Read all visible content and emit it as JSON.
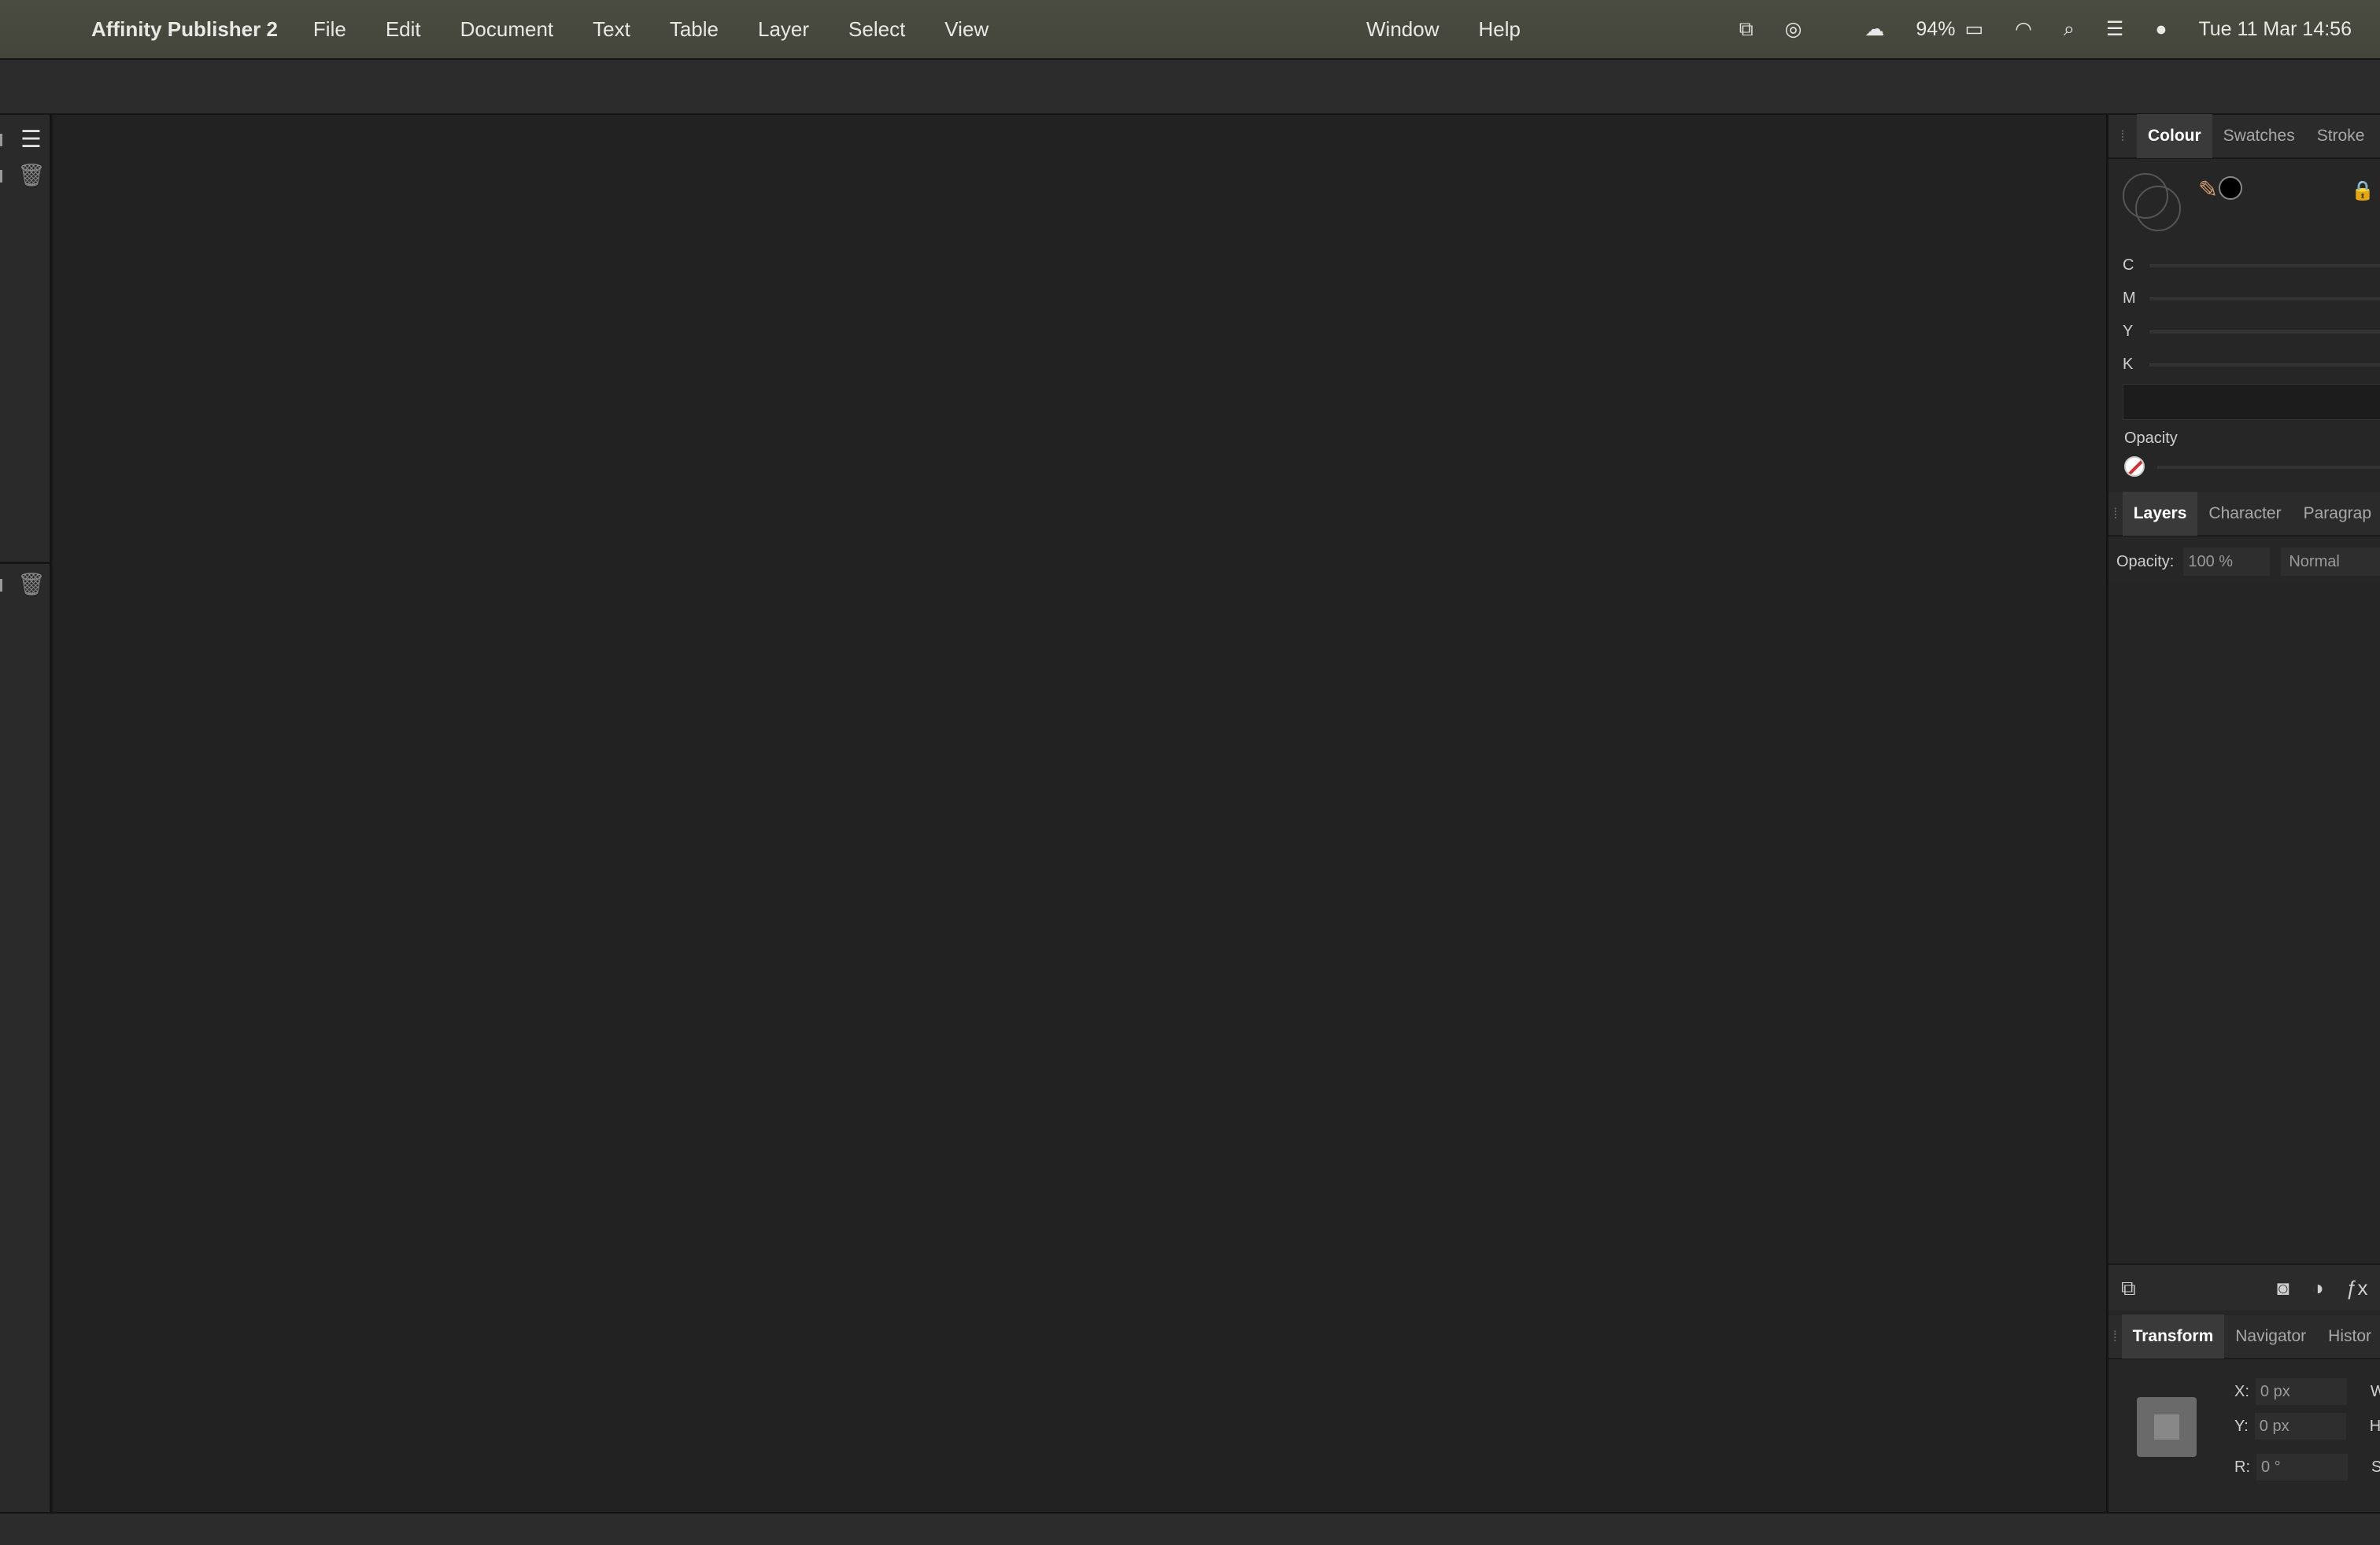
{
  "menubar": {
    "apple_glyph": "",
    "app_name": "Affinity Publisher 2",
    "menus": [
      "File",
      "Edit",
      "Document",
      "Text",
      "Table",
      "Layer",
      "Select",
      "View"
    ],
    "menus_right": [
      "Window",
      "Help"
    ],
    "battery": "94%",
    "datetime": "Tue 11 Mar  14:56",
    "icons": [
      "screen-mirror-icon",
      "cd-icon",
      "cloud-icon",
      "battery-icon",
      "wifi-icon",
      "search-icon",
      "control-center-icon",
      "siri-icon"
    ]
  },
  "colour_panel": {
    "tabs": [
      "Colour",
      "Swatches",
      "Stroke"
    ],
    "active_tab": "Colour",
    "channels": [
      "C",
      "M",
      "Y",
      "K"
    ],
    "opacity_label": "Opacity"
  },
  "layers_panel": {
    "tabs": [
      "Layers",
      "Character",
      "Paragrap"
    ],
    "active_tab": "Layers",
    "opacity_label": "Opacity:",
    "opacity_value": "100 %",
    "blend_mode": "Normal"
  },
  "transform_panel": {
    "tabs": [
      "Transform",
      "Navigator",
      "Histor"
    ],
    "active_tab": "Transform",
    "x_label": "X:",
    "x_value": "0 px",
    "y_label": "Y:",
    "y_value": "0 px",
    "r_label": "R:",
    "r_value": "0 °",
    "w_label": "W",
    "h_label": "H",
    "s_label": "S"
  },
  "colors": {
    "menubar": "#46483e",
    "canvas": "#222222",
    "panel": "#262626"
  }
}
